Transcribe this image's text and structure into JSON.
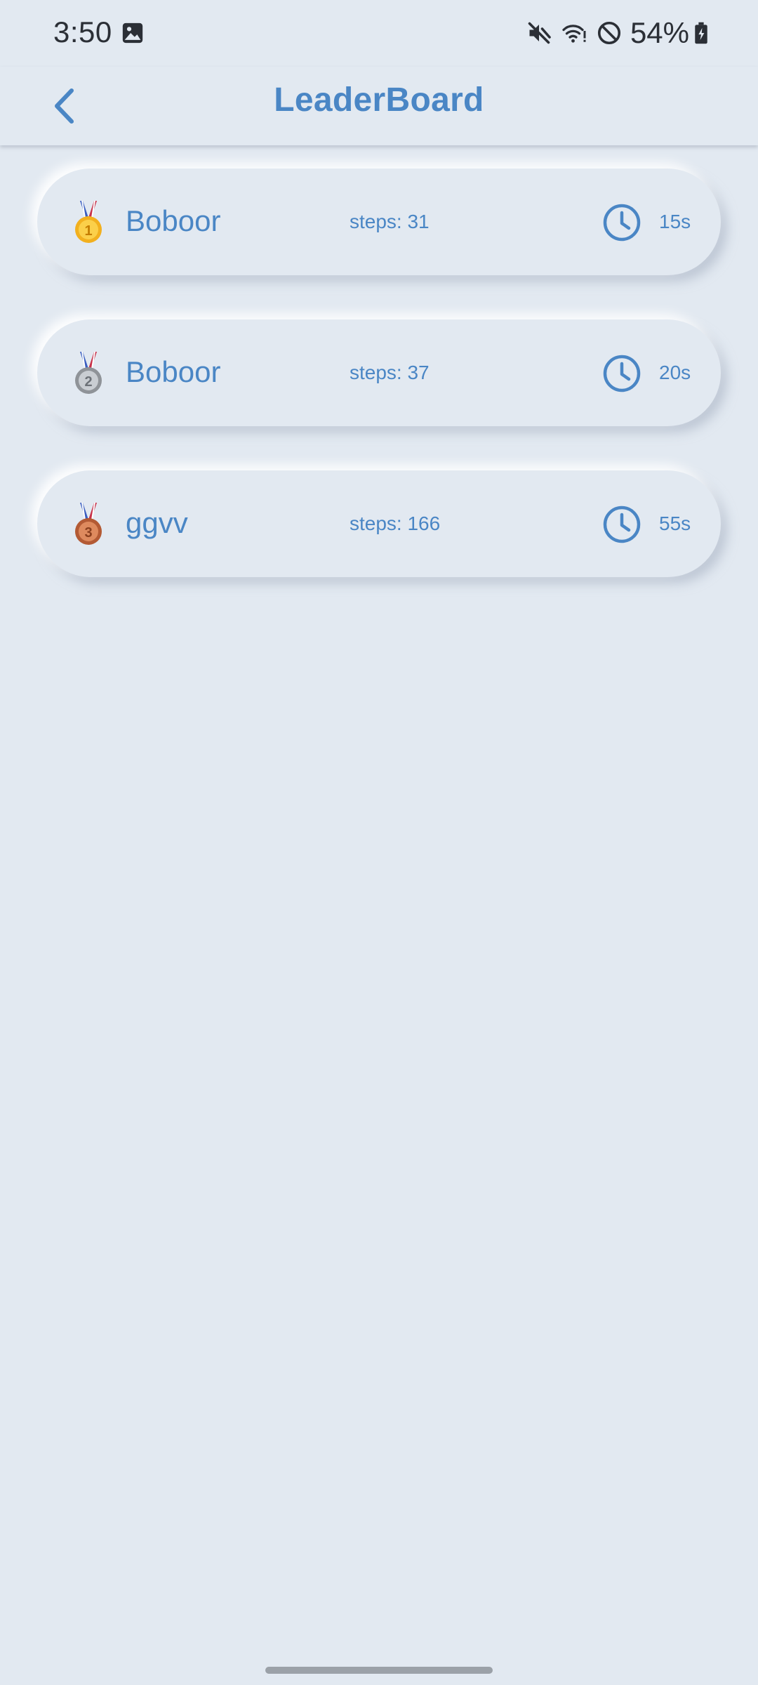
{
  "status_bar": {
    "time": "3:50",
    "battery": "54%",
    "icons": [
      "gallery-icon",
      "mute-icon",
      "wifi-icon",
      "do-not-disturb-icon",
      "battery-icon"
    ]
  },
  "app_bar": {
    "title": "LeaderBoard",
    "back_icon": "chevron-left-icon"
  },
  "leaderboard": [
    {
      "rank": 1,
      "medal": "gold-medal-icon",
      "name": "Boboor",
      "steps": "steps: 31",
      "time": "15s"
    },
    {
      "rank": 2,
      "medal": "silver-medal-icon",
      "name": "Boboor",
      "steps": "steps: 37",
      "time": "20s"
    },
    {
      "rank": 3,
      "medal": "bronze-medal-icon",
      "name": "ggvv",
      "steps": "steps: 166",
      "time": "55s"
    }
  ],
  "colors": {
    "background": "#e2e9f1",
    "accent": "#4a86c5",
    "text_dark": "#2b2f36"
  }
}
